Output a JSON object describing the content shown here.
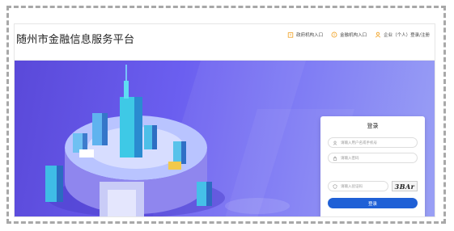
{
  "header": {
    "site_title": "随州市金融信息服务平台",
    "nav": [
      {
        "label": "政府机构入口",
        "icon": "building-icon"
      },
      {
        "label": "金融机构入口",
        "icon": "bank-icon"
      },
      {
        "label": "企业（个人）登录/注册",
        "icon": "user-icon"
      }
    ]
  },
  "login": {
    "title": "登录",
    "username_placeholder": "请输入用户名或手机号",
    "password_placeholder": "请输入密码",
    "captcha_placeholder": "请输入验证码",
    "captcha_text": "3BAr",
    "submit_label": "登录"
  },
  "colors": {
    "accent": "#1f60d6",
    "nav_icon": "#f0a020",
    "hero_start": "#5a49d9",
    "hero_end": "#9aa0f5"
  }
}
